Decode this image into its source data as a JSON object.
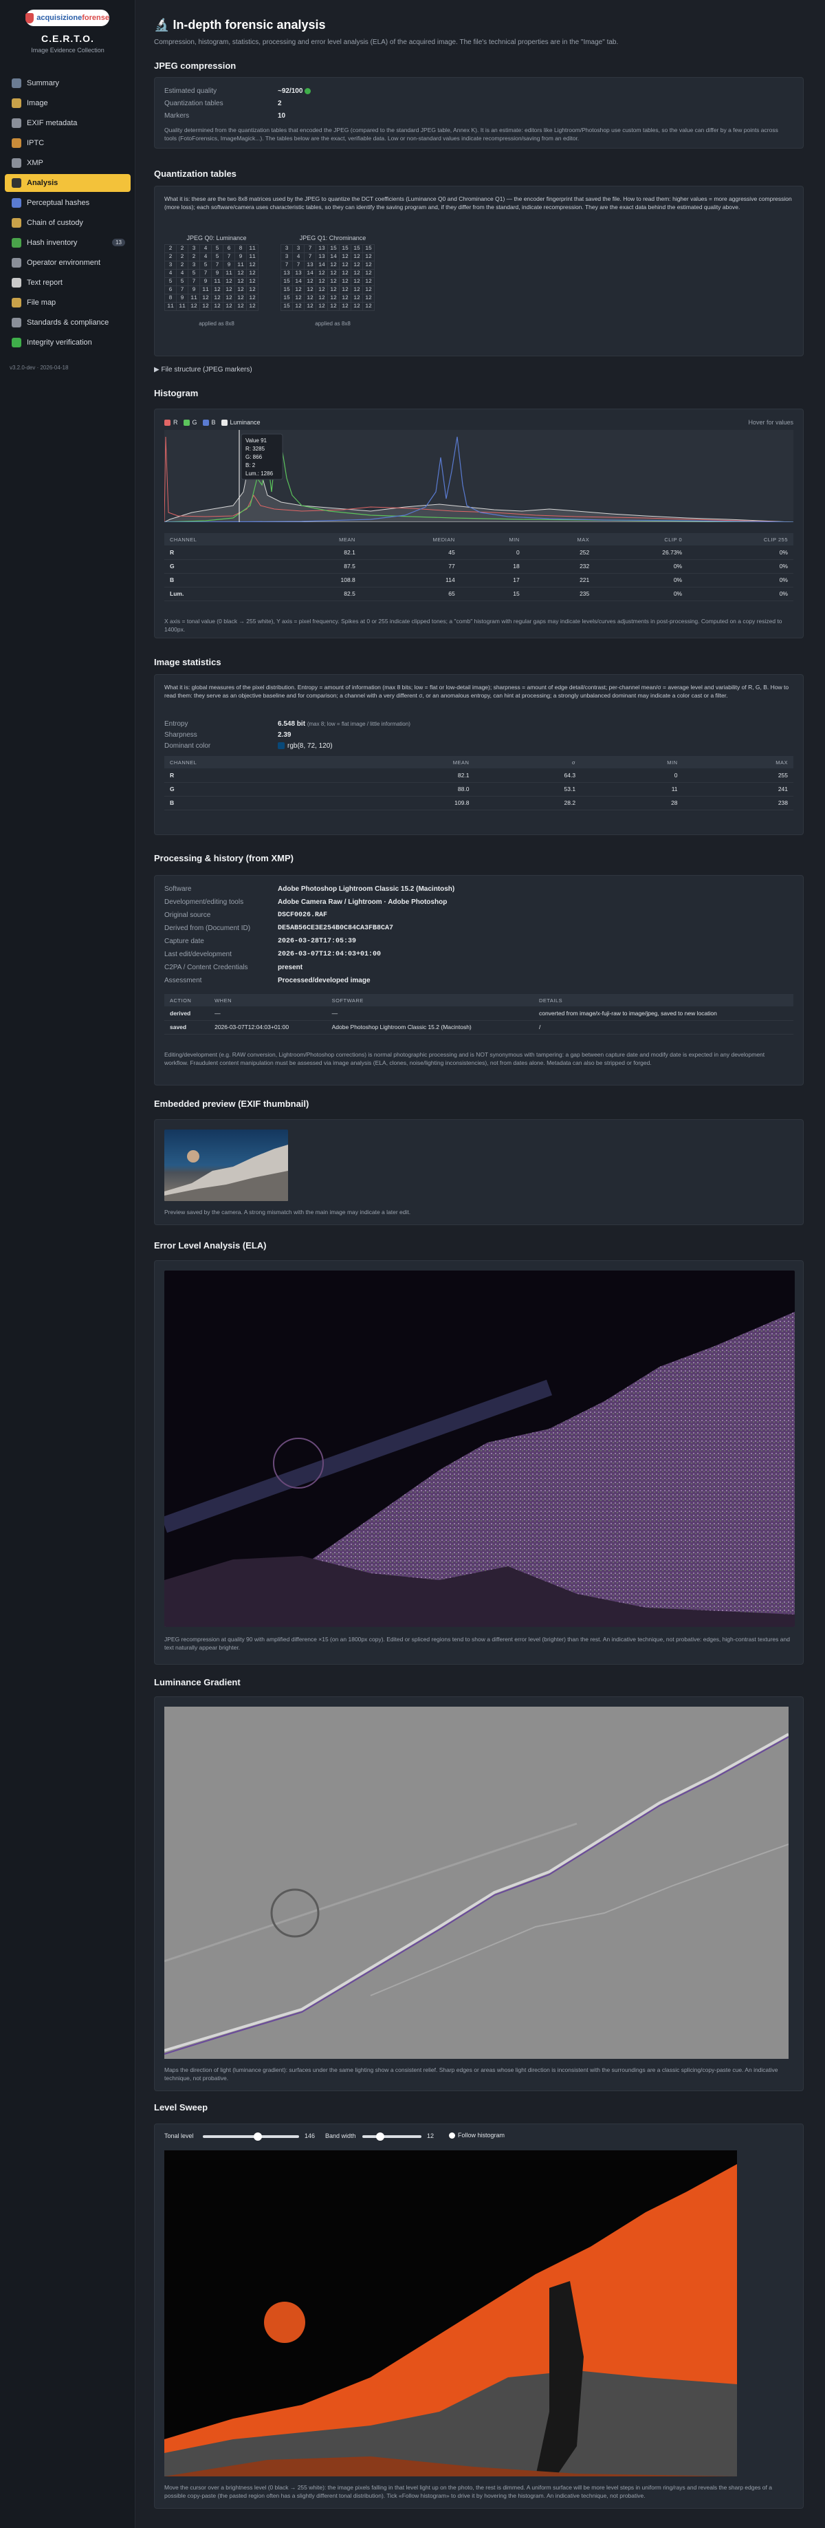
{
  "sidebar": {
    "logo_a": "acquisizione",
    "logo_b": "forense",
    "brand": "C.E.R.T.O.",
    "brand_sub": "Image Evidence Collection",
    "items": [
      {
        "label": "Summary",
        "icon": "summary-icon",
        "color": "#6b7c93"
      },
      {
        "label": "Image",
        "icon": "image-icon",
        "color": "#c9a24a"
      },
      {
        "label": "EXIF metadata",
        "icon": "exif-icon",
        "color": "#8a8f99"
      },
      {
        "label": "IPTC",
        "icon": "iptc-icon",
        "color": "#c98c3a"
      },
      {
        "label": "XMP",
        "icon": "xmp-icon",
        "color": "#8a8f99"
      },
      {
        "label": "Analysis",
        "icon": "analysis-icon",
        "color": "#333"
      },
      {
        "label": "Perceptual hashes",
        "icon": "hash-icon",
        "color": "#5a7bd1"
      },
      {
        "label": "Chain of custody",
        "icon": "chain-icon",
        "color": "#c9a24a"
      },
      {
        "label": "Hash inventory",
        "icon": "inventory-icon",
        "color": "#4aa34a",
        "badge": "13"
      },
      {
        "label": "Operator environment",
        "icon": "operator-icon",
        "color": "#8a8f99"
      },
      {
        "label": "Text report",
        "icon": "report-icon",
        "color": "#c9c9c9"
      },
      {
        "label": "File map",
        "icon": "folder-icon",
        "color": "#c9a24a"
      },
      {
        "label": "Standards & compliance",
        "icon": "standards-icon",
        "color": "#8a8f99"
      },
      {
        "label": "Integrity verification",
        "icon": "check-icon",
        "color": "#3fae4a"
      }
    ],
    "version": "v3.2.0-dev · 2026-04-18"
  },
  "page": {
    "title": "In-depth forensic analysis",
    "subtitle": "Compression, histogram, statistics, processing and error level analysis (ELA) of the acquired image. The file's technical properties are in the \"Image\" tab."
  },
  "jpeg": {
    "title": "JPEG compression",
    "rows": [
      {
        "k": "Estimated quality",
        "v": "~92/100"
      },
      {
        "k": "Quantization tables",
        "v": "2"
      },
      {
        "k": "Markers",
        "v": "10"
      }
    ],
    "note": "Quality determined from the quantization tables that encoded the JPEG (compared to the standard JPEG table, Annex K). It is an estimate: editors like Lightroom/Photoshop use custom tables, so the value can differ by a few points across tools (FotoForensics, ImageMagick...). The tables below are the exact, verifiable data. Low or non-standard values indicate recompression/saving from an editor."
  },
  "quant": {
    "title": "Quantization tables",
    "intro": "What it is: these are the two 8x8 matrices used by the JPEG to quantize the DCT coefficients (Luminance Q0 and Chrominance Q1) — the encoder fingerprint that saved the file. How to read them: higher values = more aggressive compression (more loss); each software/camera uses characteristic tables, so they can identify the saving program and, if they differ from the standard, indicate recompression. They are the exact data behind the estimated quality above.",
    "q0_title": "JPEG Q0: Luminance",
    "q1_title": "JPEG Q1: Chrominance",
    "q0": [
      [
        2,
        2,
        3,
        4,
        5,
        6,
        8,
        11
      ],
      [
        2,
        2,
        2,
        4,
        5,
        7,
        9,
        11
      ],
      [
        3,
        2,
        3,
        5,
        7,
        9,
        11,
        12
      ],
      [
        4,
        4,
        5,
        7,
        9,
        11,
        12,
        12
      ],
      [
        5,
        5,
        7,
        9,
        11,
        12,
        12,
        12
      ],
      [
        6,
        7,
        9,
        11,
        12,
        12,
        12,
        12
      ],
      [
        8,
        9,
        11,
        12,
        12,
        12,
        12,
        12
      ],
      [
        11,
        11,
        12,
        12,
        12,
        12,
        12,
        12
      ]
    ],
    "q1": [
      [
        3,
        3,
        7,
        13,
        15,
        15,
        15,
        15
      ],
      [
        3,
        4,
        7,
        13,
        14,
        12,
        12,
        12
      ],
      [
        7,
        7,
        13,
        14,
        12,
        12,
        12,
        12
      ],
      [
        13,
        13,
        14,
        12,
        12,
        12,
        12,
        12
      ],
      [
        15,
        14,
        12,
        12,
        12,
        12,
        12,
        12
      ],
      [
        15,
        12,
        12,
        12,
        12,
        12,
        12,
        12
      ],
      [
        15,
        12,
        12,
        12,
        12,
        12,
        12,
        12
      ],
      [
        15,
        12,
        12,
        12,
        12,
        12,
        12,
        12
      ]
    ],
    "q0_note": "applied as 8x8",
    "q1_note": "applied as 8x8",
    "structure": "▶ File structure (JPEG markers)"
  },
  "hist": {
    "title": "Histogram",
    "legend": [
      "R",
      "G",
      "B",
      "Luminance"
    ],
    "hover_hint": "Hover for values",
    "tooltip": [
      "Value 91",
      "R: 3285",
      "G: 866",
      "B: 2",
      "Lum.: 1286"
    ],
    "columns": [
      "CHANNEL",
      "MEAN",
      "MEDIAN",
      "MIN",
      "MAX",
      "CLIP 0",
      "CLIP 255"
    ],
    "rows": [
      [
        "R",
        "82.1",
        "45",
        "0",
        "252",
        "26.73%",
        "0%"
      ],
      [
        "G",
        "87.5",
        "77",
        "18",
        "232",
        "0%",
        "0%"
      ],
      [
        "B",
        "108.8",
        "114",
        "17",
        "221",
        "0%",
        "0%"
      ],
      [
        "Lum.",
        "82.5",
        "65",
        "15",
        "235",
        "0%",
        "0%"
      ]
    ],
    "note": "X axis = tonal value (0 black → 255 white), Y axis = pixel frequency. Spikes at 0 or 255 indicate clipped tones; a \"comb\" histogram with regular gaps may indicate levels/curves adjustments in post-processing. Computed on a copy resized to 1400px."
  },
  "stats": {
    "title": "Image statistics",
    "intro": "What it is: global measures of the pixel distribution. Entropy = amount of information (max 8 bits; low = flat or low-detail image); sharpness = amount of edge detail/contrast; per-channel mean/σ = average level and variability of R, G, B. How to read them: they serve as an objective baseline and for comparison; a channel with a very different σ, or an anomalous entropy, can hint at processing; a strongly unbalanced dominant may indicate a color cast or a filter.",
    "rows": [
      {
        "k": "Entropy",
        "v": "6.548 bit",
        "extra": "(max 8; low = flat image / little information)"
      },
      {
        "k": "Sharpness",
        "v": "2.39"
      },
      {
        "k": "Dominant color",
        "v": "rgb(8, 72, 120)"
      }
    ],
    "columns": [
      "CHANNEL",
      "MEAN",
      "σ",
      "MIN",
      "MAX"
    ],
    "rows2": [
      [
        "R",
        "82.1",
        "64.3",
        "0",
        "255"
      ],
      [
        "G",
        "88.0",
        "53.1",
        "11",
        "241"
      ],
      [
        "B",
        "109.8",
        "28.2",
        "28",
        "238"
      ]
    ]
  },
  "proc": {
    "title": "Processing & history (from XMP)",
    "rows": [
      {
        "k": "Software",
        "v": "Adobe Photoshop Lightroom Classic 15.2 (Macintosh)"
      },
      {
        "k": "Development/editing tools",
        "v": "Adobe Camera Raw / Lightroom · Adobe Photoshop"
      },
      {
        "k": "Original source",
        "v": "DSCF0026.RAF"
      },
      {
        "k": "Derived from (Document ID)",
        "v": "DE5AB56CE3E254B0C84CA3FB8CA7"
      },
      {
        "k": "Capture date",
        "v": "2026-03-28T17:05:39"
      },
      {
        "k": "Last edit/development",
        "v": "2026-03-07T12:04:03+01:00"
      },
      {
        "k": "C2PA / Content Credentials",
        "v": "present"
      },
      {
        "k": "Assessment",
        "v": "Processed/developed image"
      }
    ],
    "columns": [
      "ACTION",
      "WHEN",
      "SOFTWARE",
      "DETAILS"
    ],
    "hrows": [
      [
        "derived",
        "—",
        "—",
        "converted from image/x-fuji-raw to image/jpeg, saved to new location"
      ],
      [
        "saved",
        "2026-03-07T12:04:03+01:00",
        "Adobe Photoshop Lightroom Classic 15.2 (Macintosh)",
        "/"
      ]
    ],
    "note": "Editing/development (e.g. RAW conversion, Lightroom/Photoshop corrections) is normal photographic processing and is NOT synonymous with tampering: a gap between capture date and modify date is expected in any development workflow. Fraudulent content manipulation must be assessed via image analysis (ELA, clones, noise/lighting inconsistencies), not from dates alone. Metadata can also be stripped or forged."
  },
  "preview": {
    "title": "Embedded preview (EXIF thumbnail)",
    "note": "Preview saved by the camera. A strong mismatch with the main image may indicate a later edit."
  },
  "ela": {
    "title": "Error Level Analysis (ELA)",
    "note": "JPEG recompression at quality 90 with amplified difference ×15 (on an 1800px copy). Edited or spliced regions tend to show a different error level (brighter) than the rest. An indicative technique, not probative: edges, high-contrast textures and text naturally appear brighter."
  },
  "lum": {
    "title": "Luminance Gradient",
    "note": "Maps the direction of light (luminance gradient): surfaces under the same lighting show a consistent relief. Sharp edges or areas whose light direction is inconsistent with the surroundings are a classic splicing/copy-paste cue. An indicative technique, not probative."
  },
  "sweep": {
    "title": "Level Sweep",
    "tonal_label": "Tonal level",
    "tonal_value": "146",
    "tonal_frac": 0.57,
    "band_label": "Band width",
    "band_value": "12",
    "band_frac": 0.3,
    "follow_label": "Follow histogram",
    "note": "Move the cursor over a brightness level (0 black → 255 white): the image pixels falling in that level light up on the photo, the rest is dimmed. A uniform surface will be more level steps in uniform ring/rays and reveals the sharp edges of a possible copy-paste (the pasted region often has a slightly different tonal distribution). Tick «Follow histogram» to drive it by hovering the histogram. An indicative technique, not probative."
  }
}
